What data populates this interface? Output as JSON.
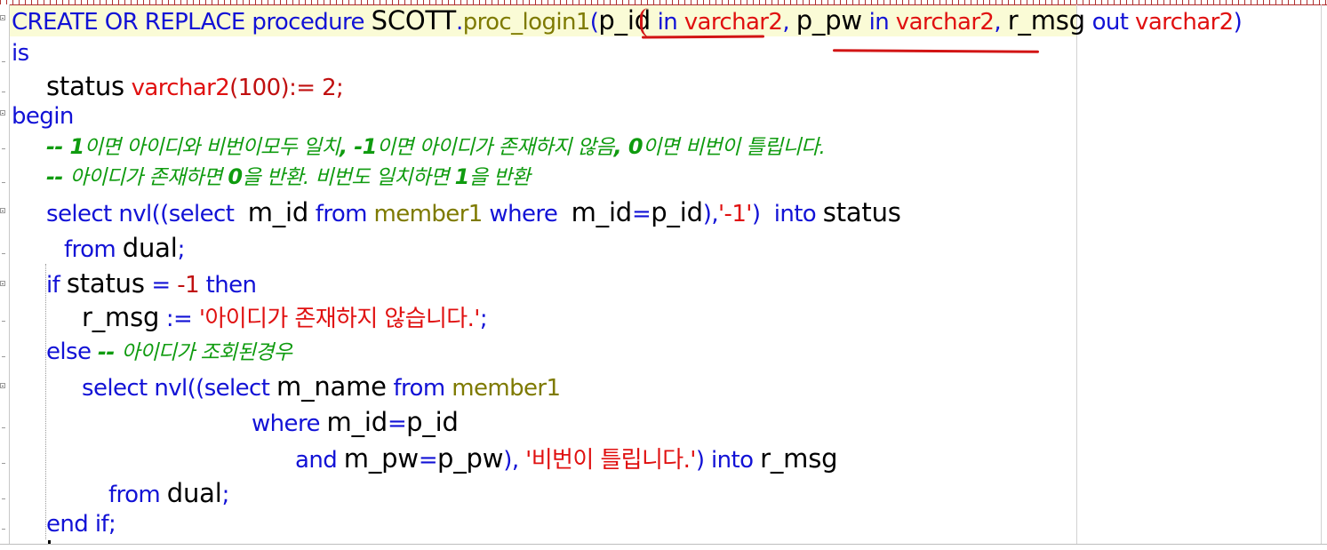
{
  "editor": {
    "colors": {
      "keyword": "#1212d6",
      "identifier": "#000000",
      "type": "#e01010",
      "function": "#7e7a00",
      "comment": "#0f9b0f",
      "string": "#e01010",
      "current_line_bg": "#fafbd6",
      "annotation": "#d21414"
    },
    "lines": [
      {
        "tokens": [
          {
            "t": "CREATE OR REPLACE procedure ",
            "c": "kw"
          },
          {
            "t": "SCOTT",
            "c": "id"
          },
          {
            "t": ".",
            "c": "kw"
          },
          {
            "t": "proc_login1",
            "c": "fn"
          },
          {
            "t": "(",
            "c": "kw"
          },
          {
            "t": "p_id",
            "c": "id"
          },
          {
            "t": " in ",
            "c": "kw"
          },
          {
            "t": "varchar2",
            "c": "ty"
          },
          {
            "t": ", ",
            "c": "kw"
          },
          {
            "t": "p_pw",
            "c": "id"
          },
          {
            "t": " in ",
            "c": "kw"
          },
          {
            "t": "varchar2",
            "c": "ty"
          },
          {
            "t": ", ",
            "c": "kw"
          },
          {
            "t": "r_msg",
            "c": "id"
          },
          {
            "t": " out ",
            "c": "kw"
          },
          {
            "t": "varchar2",
            "c": "ty"
          },
          {
            "t": ")",
            "c": "kw"
          }
        ]
      },
      {
        "tokens": [
          {
            "t": "is",
            "c": "kw"
          }
        ]
      },
      {
        "tokens": [
          {
            "t": "status",
            "c": "id"
          },
          {
            "t": " ",
            "c": "kw"
          },
          {
            "t": "varchar2",
            "c": "ty"
          },
          {
            "t": "(100)",
            "c": "num"
          },
          {
            "t": ":= 2;",
            "c": "num"
          }
        ]
      },
      {
        "tokens": [
          {
            "t": "begin",
            "c": "kw"
          }
        ]
      },
      {
        "tokens": [
          {
            "t": "-- ",
            "c": "cmb"
          },
          {
            "t": "1",
            "c": "cmb"
          },
          {
            "t": "이면 아이디와 비번이모두 일치",
            "c": "cm"
          },
          {
            "t": ", -1",
            "c": "cmb"
          },
          {
            "t": "이면 아이디가 존재하지 않음",
            "c": "cm"
          },
          {
            "t": ", 0",
            "c": "cmb"
          },
          {
            "t": "이면 비번이 틀립니다.",
            "c": "cm"
          }
        ]
      },
      {
        "tokens": [
          {
            "t": "-- ",
            "c": "cmb"
          },
          {
            "t": "아이디가 존재하면 ",
            "c": "cm"
          },
          {
            "t": "0",
            "c": "cmb"
          },
          {
            "t": "을 반환. 비번도 일치하면 ",
            "c": "cm"
          },
          {
            "t": "1",
            "c": "cmb"
          },
          {
            "t": "을 반환",
            "c": "cm"
          }
        ]
      },
      {
        "tokens": [
          {
            "t": "select nvl((select  ",
            "c": "kw"
          },
          {
            "t": "m_id",
            "c": "id"
          },
          {
            "t": " from ",
            "c": "kw"
          },
          {
            "t": "member1",
            "c": "fn"
          },
          {
            "t": " where  ",
            "c": "kw"
          },
          {
            "t": "m_id",
            "c": "id"
          },
          {
            "t": "=",
            "c": "kw"
          },
          {
            "t": "p_id",
            "c": "id"
          },
          {
            "t": "),",
            "c": "kw"
          },
          {
            "t": "'-1'",
            "c": "str"
          },
          {
            "t": ")  into ",
            "c": "kw"
          },
          {
            "t": "status",
            "c": "id"
          }
        ]
      },
      {
        "tokens": [
          {
            "t": "from ",
            "c": "kw"
          },
          {
            "t": "dual",
            "c": "id"
          },
          {
            "t": ";",
            "c": "kw"
          }
        ]
      },
      {
        "tokens": [
          {
            "t": "if ",
            "c": "kw"
          },
          {
            "t": "status",
            "c": "id"
          },
          {
            "t": " = ",
            "c": "kw"
          },
          {
            "t": "-1",
            "c": "num"
          },
          {
            "t": " then",
            "c": "kw"
          }
        ]
      },
      {
        "tokens": [
          {
            "t": "r_msg",
            "c": "id"
          },
          {
            "t": " := ",
            "c": "kw"
          },
          {
            "t": "'아이디가 존재하지 않습니다.'",
            "c": "str"
          },
          {
            "t": ";",
            "c": "kw"
          }
        ]
      },
      {
        "tokens": [
          {
            "t": "else ",
            "c": "kw"
          },
          {
            "t": "-- ",
            "c": "cmb"
          },
          {
            "t": "아이디가 조회된경우",
            "c": "cm"
          }
        ]
      },
      {
        "tokens": [
          {
            "t": "select nvl((select ",
            "c": "kw"
          },
          {
            "t": "m_name",
            "c": "id"
          },
          {
            "t": " from ",
            "c": "kw"
          },
          {
            "t": "member1",
            "c": "fn"
          }
        ]
      },
      {
        "tokens": [
          {
            "t": "where ",
            "c": "kw"
          },
          {
            "t": "m_id",
            "c": "id"
          },
          {
            "t": "=",
            "c": "kw"
          },
          {
            "t": "p_id",
            "c": "id"
          }
        ]
      },
      {
        "tokens": [
          {
            "t": "and ",
            "c": "kw"
          },
          {
            "t": "m_pw",
            "c": "id"
          },
          {
            "t": "=",
            "c": "kw"
          },
          {
            "t": "p_pw",
            "c": "id"
          },
          {
            "t": "), ",
            "c": "kw"
          },
          {
            "t": "'비번이 틀립니다.'",
            "c": "str"
          },
          {
            "t": ") into ",
            "c": "kw"
          },
          {
            "t": "r_msg",
            "c": "id"
          }
        ]
      },
      {
        "tokens": [
          {
            "t": "from ",
            "c": "kw"
          },
          {
            "t": "dual",
            "c": "id"
          },
          {
            "t": ";",
            "c": "kw"
          }
        ]
      },
      {
        "tokens": [
          {
            "t": "end if",
            "c": "kw"
          },
          {
            "t": ";",
            "c": "kw"
          }
        ]
      }
    ]
  }
}
